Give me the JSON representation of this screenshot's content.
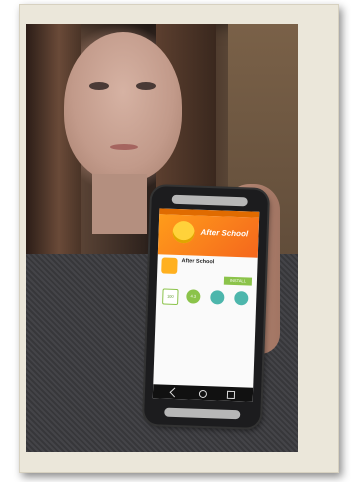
{
  "phone_screen": {
    "banner_text": "After School",
    "app_title": "After School",
    "install_label": "INSTALL",
    "badge_rating": "4.3",
    "badge_downloads": "100"
  },
  "colors": {
    "frame": "#ebe7da",
    "banner": "#f5671d",
    "install": "#8bc34a"
  }
}
